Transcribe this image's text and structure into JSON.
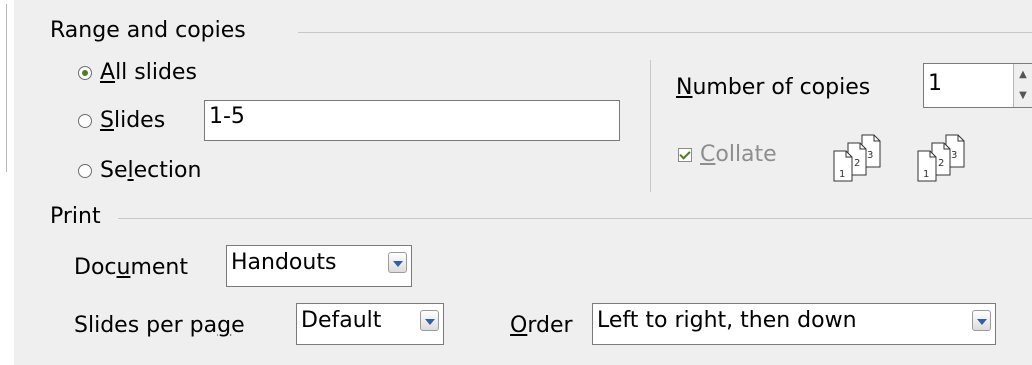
{
  "range": {
    "title": "Range and copies",
    "options": [
      {
        "pre": "",
        "key": "A",
        "post": "ll slides",
        "selected": true
      },
      {
        "pre": "",
        "key": "S",
        "post": "lides",
        "selected": false
      },
      {
        "pre": "Se",
        "key": "l",
        "post": "ection",
        "selected": false
      }
    ],
    "slides_value": "1-5"
  },
  "copies": {
    "label_key": "N",
    "label_rest": "umber of copies",
    "value": "1",
    "collate": {
      "key": "C",
      "rest": "ollate",
      "checked": true,
      "enabled": false
    },
    "icon_pages": [
      "1",
      "2",
      "3"
    ]
  },
  "print": {
    "title": "Print",
    "document": {
      "pre": "Doc",
      "key": "u",
      "post": "ment",
      "value": "Handouts"
    },
    "slides_per_page": {
      "pre": "Slides per pa",
      "key": "g",
      "post": "e",
      "value": "Default"
    },
    "order": {
      "pre": "",
      "key": "O",
      "post": "rder",
      "value": "Left to right, then down"
    }
  },
  "colors": {
    "radio_dot": "#4d7f1f",
    "dropdown_arrow": "#2f5fa6",
    "panel_bg": "#efefef"
  },
  "icons": [
    "radio-icon",
    "checkbox-icon",
    "collate-pages-icon",
    "dropdown-arrow-icon",
    "spin-up-icon",
    "spin-down-icon"
  ]
}
